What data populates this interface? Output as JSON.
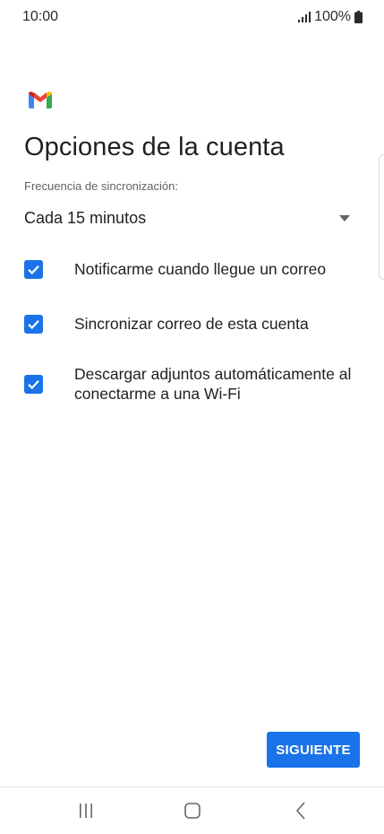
{
  "status_bar": {
    "time": "10:00",
    "battery": "100%",
    "icons": [
      "signal-icon",
      "battery-icon"
    ]
  },
  "header": {
    "logo": "gmail-icon",
    "title": "Opciones de la cuenta"
  },
  "sync": {
    "label": "Frecuencia de sincronización:",
    "selected": "Cada 15 minutos"
  },
  "options": [
    {
      "label": "Notificarme cuando llegue un correo",
      "checked": true
    },
    {
      "label": "Sincronizar correo de esta cuenta",
      "checked": true
    },
    {
      "label": "Descargar adjuntos automáticamente al conectarme a una Wi-Fi",
      "checked": true
    }
  ],
  "actions": {
    "next_label": "SIGUIENTE"
  },
  "nav": {
    "items": [
      "recent-apps-icon",
      "home-icon",
      "back-icon"
    ]
  },
  "colors": {
    "accent": "#1a73e8",
    "text": "#202124",
    "secondary_text": "#5f6368"
  }
}
